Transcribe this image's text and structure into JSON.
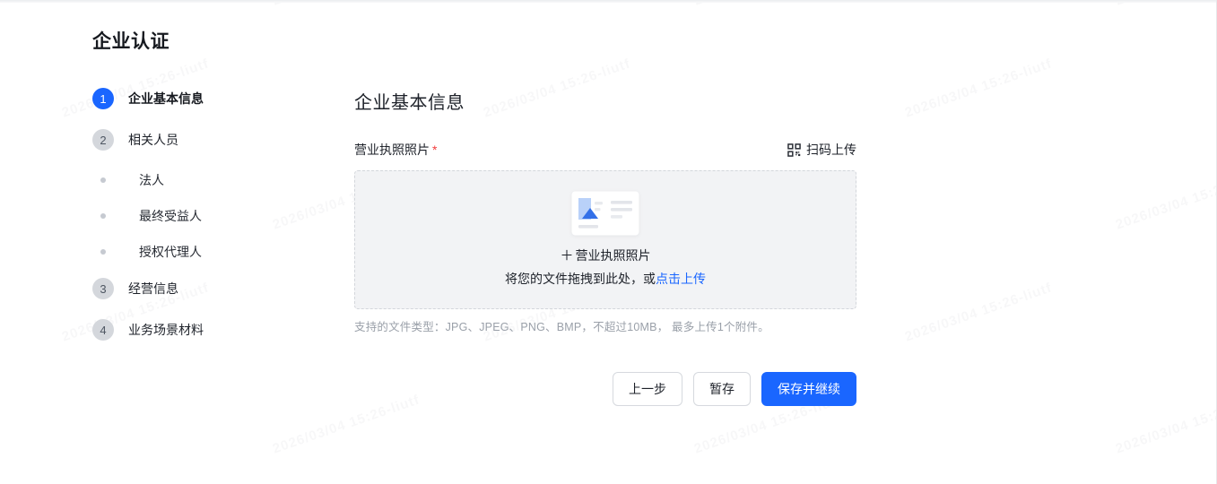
{
  "page": {
    "title": "企业认证"
  },
  "sidebar": {
    "steps": [
      {
        "num": "1",
        "label": "企业基本信息"
      },
      {
        "num": "2",
        "label": "相关人员",
        "children": [
          "法人",
          "最终受益人",
          "授权代理人"
        ]
      },
      {
        "num": "3",
        "label": "经营信息"
      },
      {
        "num": "4",
        "label": "业务场景材料"
      }
    ]
  },
  "main": {
    "section_title": "企业基本信息",
    "field_label": "营业执照照片",
    "required_mark": "*",
    "scan_upload_label": "扫码上传",
    "dropzone": {
      "plus": "＋",
      "title": "营业执照照片",
      "drag_text": "将您的文件拖拽到此处，或",
      "click_link": "点击上传"
    },
    "helper_text": "支持的文件类型：JPG、JPEG、PNG、BMP，不超过10MB， 最多上传1个附件。",
    "buttons": {
      "prev": "上一步",
      "temp_save": "暂存",
      "save_continue": "保存并继续"
    }
  },
  "watermark": {
    "text": "2026/03/04 15:26-liutf"
  },
  "colors": {
    "primary": "#1a66ff",
    "required": "#f23c3c"
  }
}
